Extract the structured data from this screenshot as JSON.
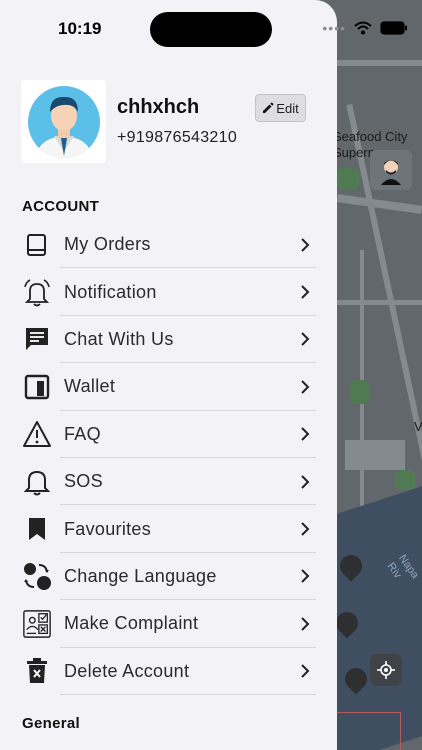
{
  "status_bar": {
    "time": "10:19"
  },
  "profile": {
    "name": "chhxhch",
    "phone": "+919876543210",
    "edit_label": "Edit"
  },
  "sections": {
    "account": "ACCOUNT",
    "general": "General"
  },
  "menu": [
    {
      "label": "My Orders",
      "icon": "book-icon"
    },
    {
      "label": "Notification",
      "icon": "bell-icon"
    },
    {
      "label": "Chat With Us",
      "icon": "chat-icon"
    },
    {
      "label": "Wallet",
      "icon": "wallet-icon"
    },
    {
      "label": "FAQ",
      "icon": "warning-icon"
    },
    {
      "label": "SOS",
      "icon": "bell-outline-icon"
    },
    {
      "label": "Favourites",
      "icon": "bookmark-icon"
    },
    {
      "label": "Change Language",
      "icon": "language-icon"
    },
    {
      "label": "Make Complaint",
      "icon": "complaint-icon"
    },
    {
      "label": "Delete Account",
      "icon": "trash-icon"
    }
  ],
  "map": {
    "label_1": "Seafood City",
    "label_2": "Superm",
    "label_3": "Napa Riv",
    "label_4": "V"
  },
  "colors": {
    "drawer_bg": "#f2f2f7",
    "map_bg": "#62676c",
    "text": "#2b2b2b"
  }
}
